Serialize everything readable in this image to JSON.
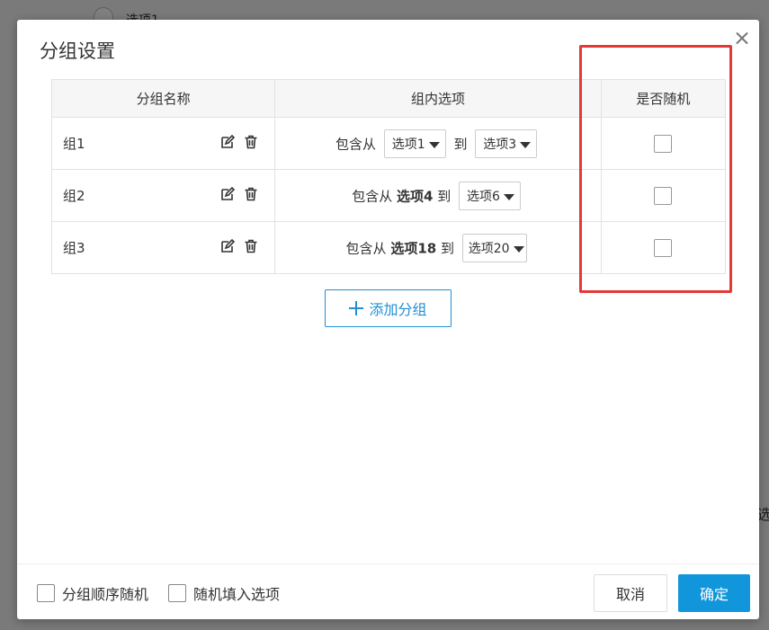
{
  "background": {
    "radio_label": "选项1",
    "edge_text": "选"
  },
  "dialog": {
    "title": "分组设置"
  },
  "table": {
    "headers": [
      "分组名称",
      "组内选项",
      "是否随机"
    ],
    "rows": [
      {
        "name": "组1",
        "prefix": "包含从",
        "from": "选项1",
        "from_is_select": true,
        "to_label": "到",
        "to": "选项3",
        "randomize": false
      },
      {
        "name": "组2",
        "prefix": "包含从",
        "from": "选项4",
        "from_is_select": false,
        "to_label": "到",
        "to": "选项6",
        "randomize": false
      },
      {
        "name": "组3",
        "prefix": "包含从",
        "from": "选项18",
        "from_is_select": false,
        "to_label": "到",
        "to": "选项20",
        "randomize": false
      }
    ]
  },
  "add_group_label": "添加分组",
  "footer": {
    "shuffle_groups_label": "分组顺序随机",
    "shuffle_groups_checked": false,
    "random_fill_label": "随机填入选项",
    "random_fill_checked": false,
    "cancel_label": "取消",
    "ok_label": "确定"
  },
  "colors": {
    "primary": "#1296db",
    "highlight": "#e53935"
  },
  "icons": {
    "edit": "edit-icon",
    "delete": "trash-icon",
    "close": "close-icon",
    "add": "plus-icon"
  }
}
